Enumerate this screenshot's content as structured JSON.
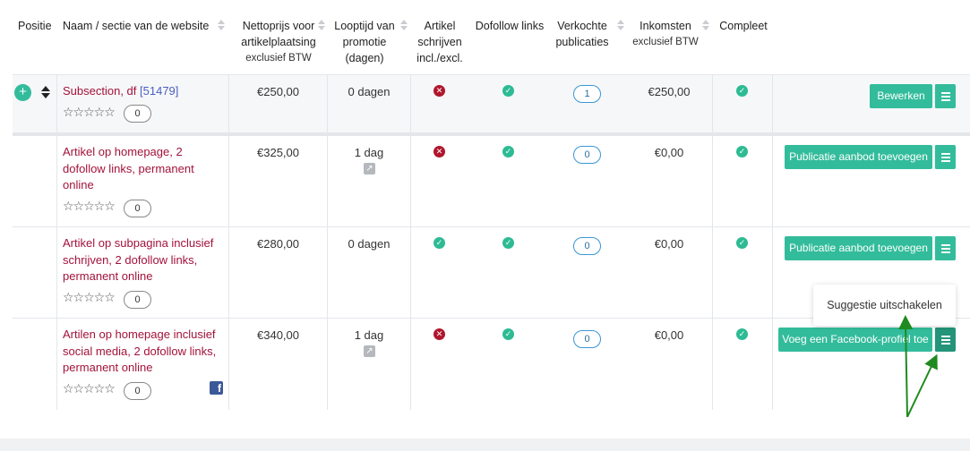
{
  "headers": {
    "position": "Positie",
    "name": "Naam / sectie van de website",
    "price_line1": "Nettoprijs voor",
    "price_line2": "artikelplaatsing",
    "price_sub": "exclusief BTW",
    "duration_line1": "Looptijd van",
    "duration_line2": "promotie",
    "duration_line3": "(dagen)",
    "writing_line1": "Artikel",
    "writing_line2": "schrijven",
    "writing_line3": "incl./excl.",
    "dofollow": "Dofollow links",
    "sold_line1": "Verkochte",
    "sold_line2": "publicaties",
    "revenue_line1": "Inkomsten",
    "revenue_sub": "exclusief BTW",
    "complete": "Compleet"
  },
  "section": {
    "name": "Subsection, df",
    "id": "[51479]",
    "rating_count": "0",
    "price": "€250,00",
    "duration": "0 dagen",
    "writing": "no",
    "dofollow": "yes",
    "sold": "1",
    "revenue": "€250,00",
    "complete": "yes",
    "action": "Bewerken"
  },
  "rows": [
    {
      "name": "Artikel op homepage, 2 dofollow links, permanent online",
      "rating_count": "0",
      "price": "€325,00",
      "duration": "1 dag",
      "writing": "no",
      "dofollow": "yes",
      "sold": "0",
      "revenue": "€0,00",
      "complete": "yes",
      "action": "Publicatie aanbod toevoegen"
    },
    {
      "name": "Artikel op subpagina inclusief schrijven, 2 dofollow links, permanent online",
      "rating_count": "0",
      "price": "€280,00",
      "duration": "0 dagen",
      "writing": "yes",
      "dofollow": "yes",
      "sold": "0",
      "revenue": "€0,00",
      "complete": "yes",
      "action": "Publicatie aanbod toevoegen"
    },
    {
      "name": "Artilen op homepage inclusief social media, 2 dofollow links, permanent online",
      "rating_count": "0",
      "price": "€340,00",
      "duration": "1 dag",
      "writing": "no",
      "dofollow": "yes",
      "sold": "0",
      "revenue": "€0,00",
      "complete": "yes",
      "action": "Voeg een Facebook-profiel toe"
    }
  ],
  "popup": {
    "label": "Suggestie uitschakelen"
  },
  "stars": "☆☆☆☆☆",
  "icons": {
    "ok": "check-circle-icon",
    "no": "x-circle-icon",
    "external": "external-link-icon",
    "facebook": "facebook-icon"
  },
  "colors": {
    "accent": "#33bc9b",
    "name_link": "#a3123b",
    "id_link": "#4a5fc1",
    "error": "#b0172c",
    "annotation_arrow": "#1f8a1f"
  }
}
